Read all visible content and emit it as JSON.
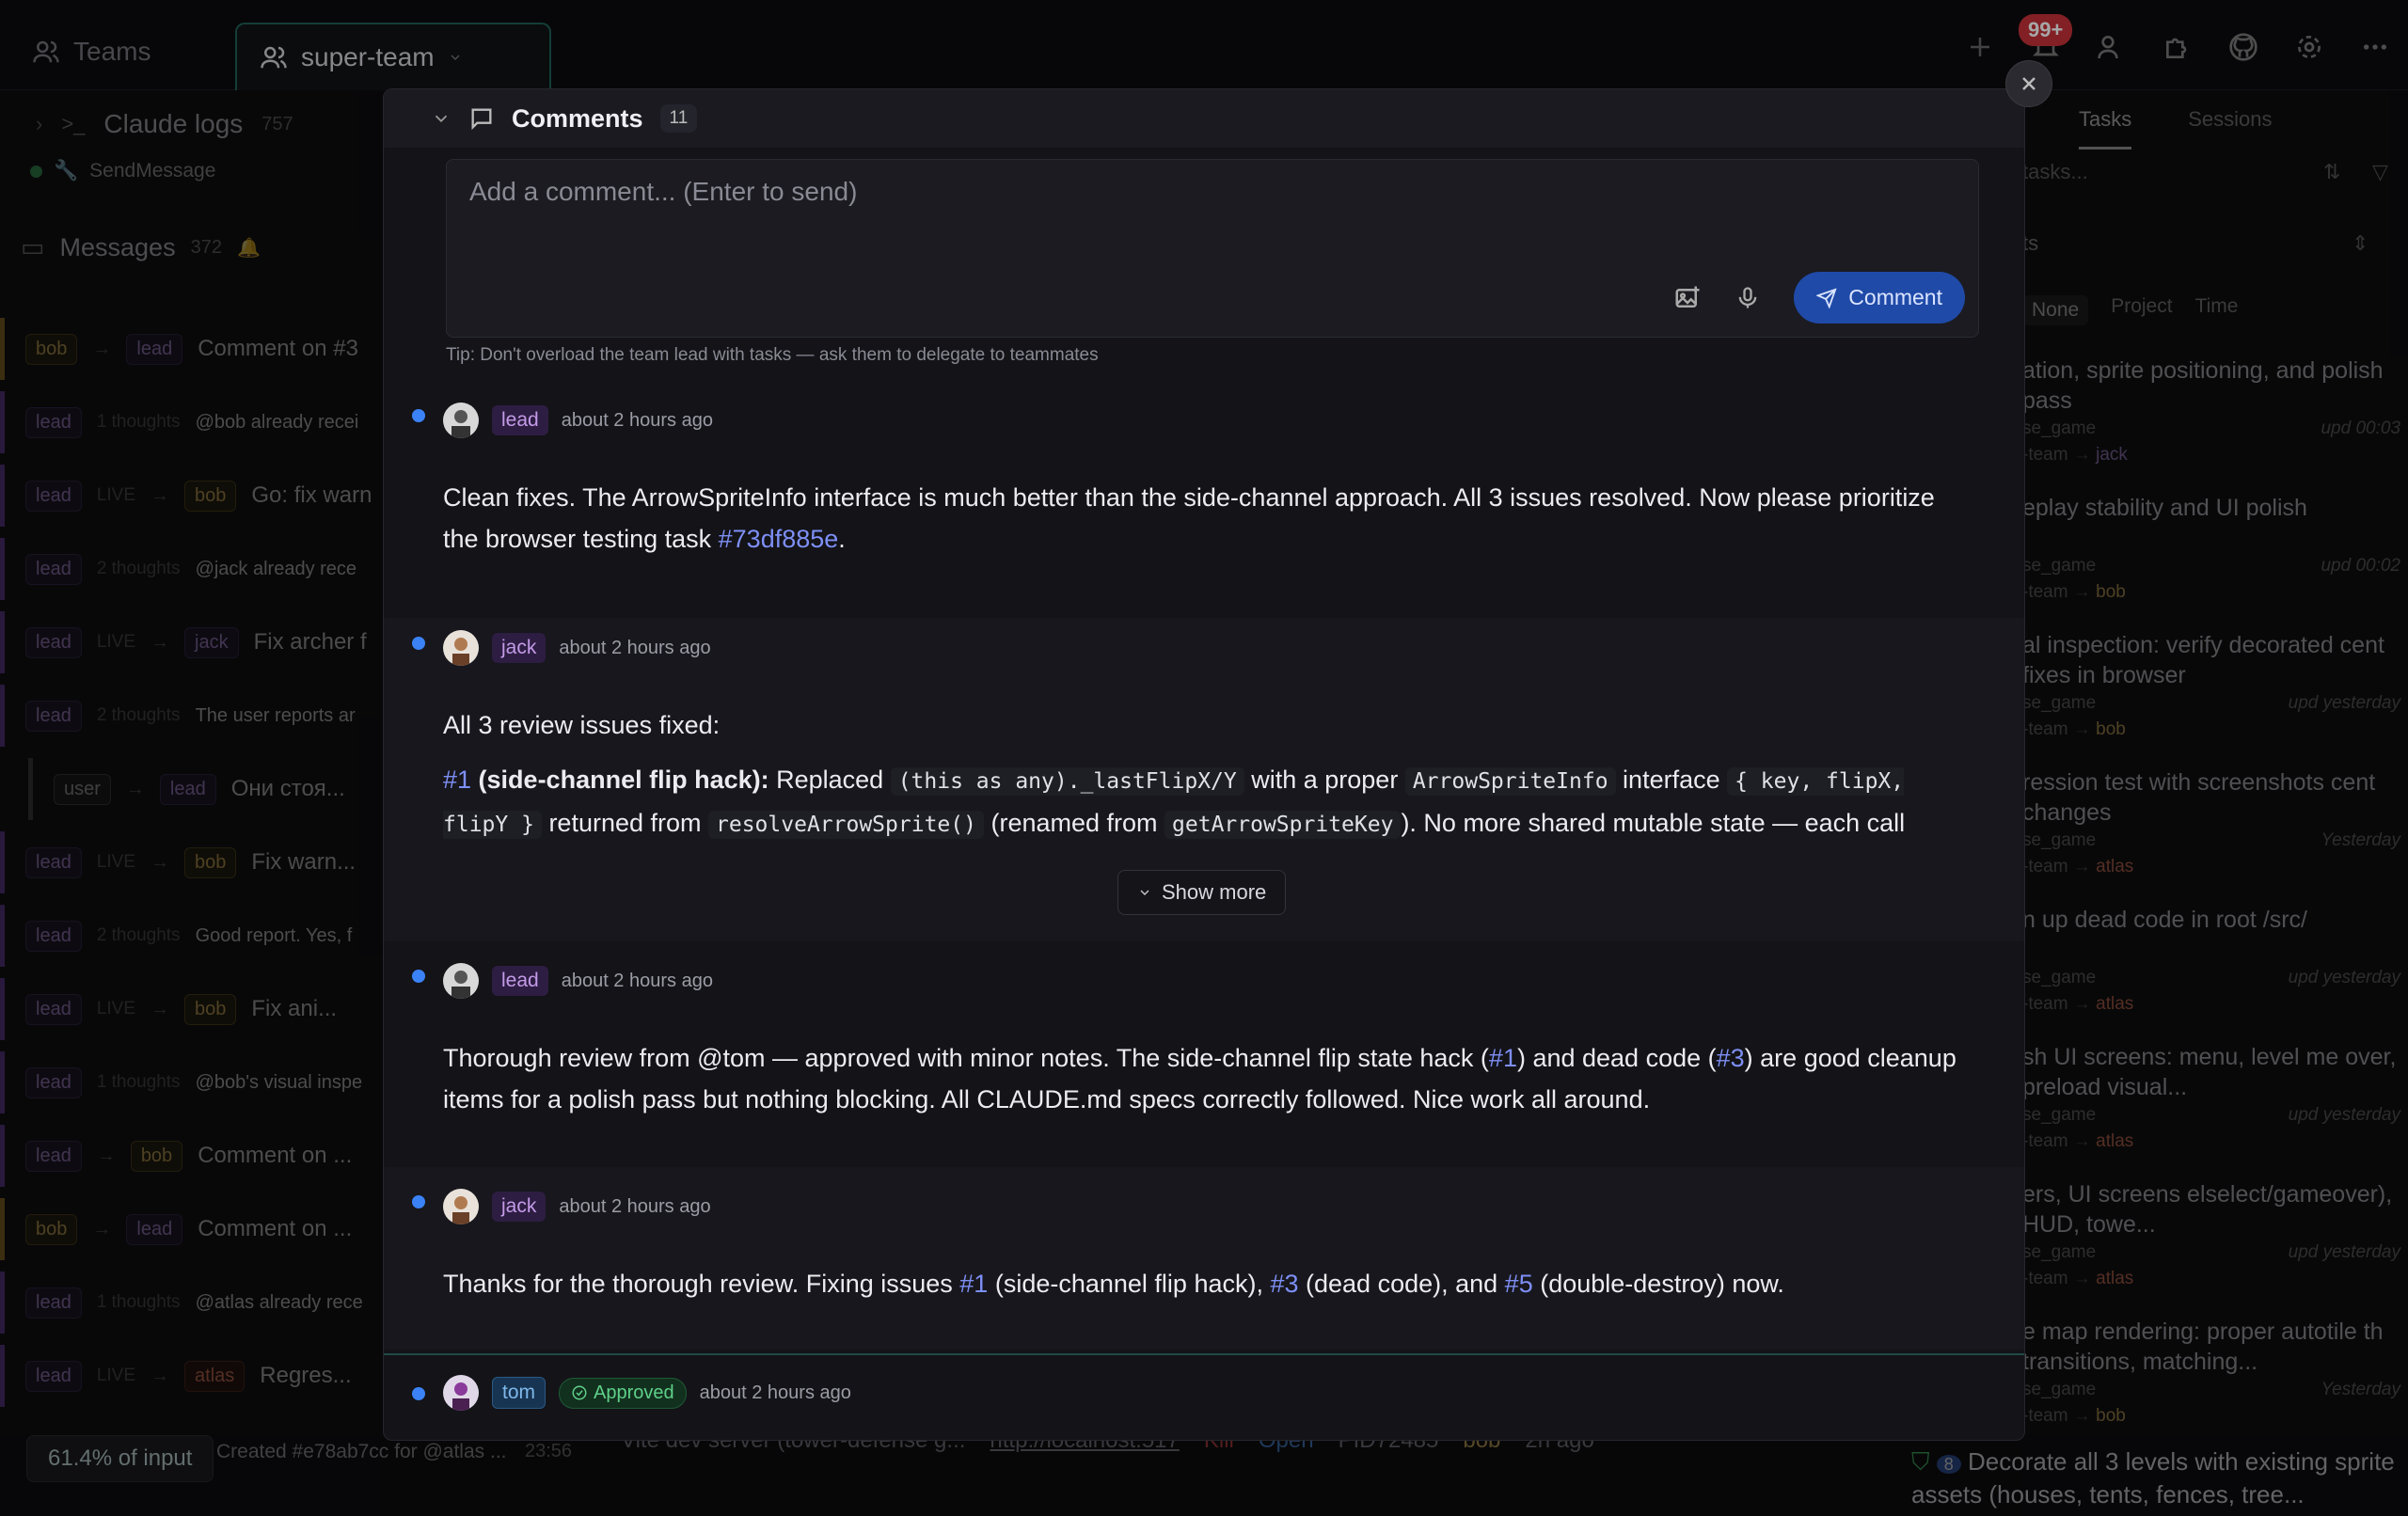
{
  "topbar": {
    "tab_teams": "Teams",
    "tab_team": "super-team",
    "notif_badge": "99+"
  },
  "left": {
    "header": "Claude logs",
    "header_count": "757",
    "sub_label": "SendMessage",
    "messages_label": "Messages",
    "messages_count": "372",
    "rows": [
      {
        "from": "bob",
        "to": "lead",
        "meta": "",
        "text": "Comment on #3",
        "color": "gold"
      },
      {
        "from": "lead",
        "to": "",
        "meta": "1 thoughts",
        "text": "@bob already recei",
        "color": "purple"
      },
      {
        "from": "lead",
        "to": "bob",
        "meta": "LIVE",
        "text": "Go: fix warn",
        "color": "purple"
      },
      {
        "from": "lead",
        "to": "",
        "meta": "2 thoughts",
        "text": "@jack already rece",
        "color": "purple"
      },
      {
        "from": "lead",
        "to": "jack",
        "meta": "LIVE",
        "text": "Fix archer f",
        "color": "purple"
      },
      {
        "from": "lead",
        "to": "",
        "meta": "2 thoughts",
        "text": "The user reports ar",
        "color": "purple"
      },
      {
        "from": "user",
        "to": "lead",
        "meta": "",
        "text": "Они стоя...",
        "color": "user"
      },
      {
        "from": "lead",
        "to": "bob",
        "meta": "LIVE",
        "text": "Fix warn...",
        "color": "purple"
      },
      {
        "from": "lead",
        "to": "",
        "meta": "2 thoughts",
        "text": "Good report. Yes, f",
        "color": "purple"
      },
      {
        "from": "lead",
        "to": "bob",
        "meta": "LIVE",
        "text": "Fix ani...",
        "color": "purple"
      },
      {
        "from": "lead",
        "to": "",
        "meta": "1 thoughts",
        "text": "@bob's visual inspe",
        "color": "purple"
      },
      {
        "from": "lead",
        "to": "bob",
        "meta": "",
        "text": "Comment on ...",
        "color": "purple"
      },
      {
        "from": "bob",
        "to": "lead",
        "meta": "",
        "text": "Comment on ...",
        "color": "gold"
      },
      {
        "from": "lead",
        "to": "",
        "meta": "1 thoughts",
        "text": "@atlas already rece",
        "color": "purple"
      },
      {
        "from": "lead",
        "to": "atlas",
        "meta": "LIVE",
        "text": "Regres...",
        "color": "purple"
      }
    ],
    "input_pct": "61.4% of input",
    "last_row": "Created #e78ab7cc for @atlas ...",
    "last_time": "23:56"
  },
  "right": {
    "tab_tasks": "Tasks",
    "tab_sessions": "Sessions",
    "search_ph": "tasks...",
    "group_sel": "ts",
    "group_opts": [
      "None",
      "Project",
      "Time"
    ],
    "cards": [
      {
        "title": "ation, sprite positioning, and polish pass",
        "proj": "se_game",
        "team": "-team",
        "who": "jack",
        "upd": "upd 00:03"
      },
      {
        "title": "eplay stability and UI polish",
        "proj": "se_game",
        "team": "-team",
        "who": "bob",
        "upd": "upd 00:02"
      },
      {
        "title": "al inspection: verify decorated cent fixes in browser",
        "proj": "se_game",
        "team": "-team",
        "who": "bob",
        "upd": "upd yesterday"
      },
      {
        "title": "ression test with screenshots cent changes",
        "proj": "se_game",
        "team": "-team",
        "who": "atlas",
        "upd": "Yesterday"
      },
      {
        "title": "n up dead code in root /src/",
        "proj": "se_game",
        "team": "-team",
        "who": "atlas",
        "upd": "upd yesterday"
      },
      {
        "title": "sh UI screens: menu, level me over, preload visual...",
        "proj": "se_game",
        "team": "-team",
        "who": "atlas",
        "upd": "upd yesterday"
      },
      {
        "title": "ers, UI screens elselect/gameover), HUD, towe...",
        "proj": "se_game",
        "team": "-team",
        "who": "atlas",
        "upd": "upd yesterday"
      },
      {
        "title": "e map rendering: proper autotile th transitions, matching...",
        "proj": "se_game",
        "team": "-team",
        "who": "bob",
        "upd": "Yesterday"
      }
    ],
    "bottom_card_num": "8",
    "bottom_card": "Decorate all 3 levels with existing sprite assets (houses, tents, fences, tree..."
  },
  "bottom_strip": {
    "text": "Vite dev server (tower-defense g...",
    "url": "http://localhost:517",
    "kill": "Kill",
    "open": "Open",
    "pid": "PID72485",
    "who": "bob",
    "age": "2h ago"
  },
  "modal": {
    "title": "Comments",
    "count": "11",
    "composer_placeholder": "Add a comment... (Enter to send)",
    "send_label": "Comment",
    "tip": "Tip: Don't overload the team lead with tasks — ask them to delegate to teammates",
    "show_more": "Show more",
    "comments": [
      {
        "author": "lead",
        "time": "about 2 hours ago"
      },
      {
        "author": "jack",
        "time": "about 2 hours ago"
      },
      {
        "author": "lead",
        "time": "about 2 hours ago"
      },
      {
        "author": "jack",
        "time": "about 2 hours ago"
      },
      {
        "author": "tom",
        "time": "about 2 hours ago",
        "status": "Approved"
      }
    ],
    "c1": {
      "text": "Clean fixes. The ArrowSpriteInfo interface is much better than the side-channel approach. All 3 issues resolved. Now please prioritize the browser testing task ",
      "link": "#73df885e",
      "end": "."
    },
    "c2": {
      "intro": "All 3 review issues fixed:",
      "ref": "#1",
      "bold": " (side-channel flip hack):",
      "t1": " Replaced ",
      "code1": "(this as any)._lastFlipX/Y",
      "t2": " with a proper ",
      "code2": "ArrowSpriteInfo",
      "t3": " interface ",
      "code3": "{ key, flipX, flipY }",
      "t4": " returned from ",
      "code4": "resolveArrowSprite()",
      "t5": " (renamed from ",
      "code5": "getArrowSpriteKey",
      "t6": "). No more shared mutable state — each call returns its own result object."
    },
    "c3": {
      "t1": "Thorough review from @tom — approved with minor notes. The side-channel flip state hack (",
      "r1": "#1",
      "t2": ") and dead code (",
      "r2": "#3",
      "t3": ") are good cleanup items for a polish pass but nothing blocking. All CLAUDE.md specs correctly followed. Nice work all around."
    },
    "c4": {
      "t1": "Thanks for the thorough review. Fixing issues ",
      "r1": "#1",
      "t2": " (side-channel flip hack), ",
      "r2": "#3",
      "t3": " (dead code), and ",
      "r3": "#5",
      "t4": " (double-destroy) now."
    }
  }
}
